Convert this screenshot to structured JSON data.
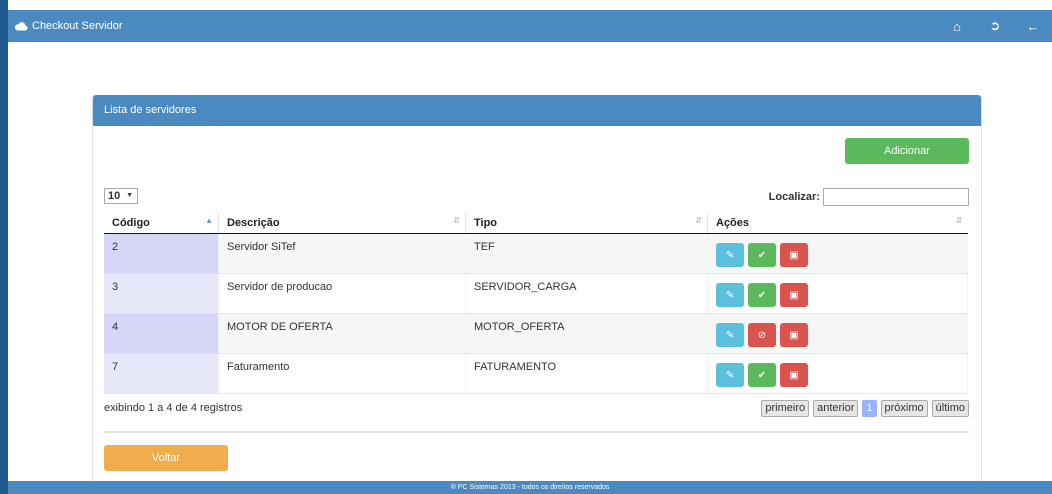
{
  "topbar": {
    "brand": "Checkout Servidor",
    "icons": [
      "home-icon",
      "sign-out-icon",
      "back-arrow-icon"
    ]
  },
  "panel": {
    "title": "Lista de servidores",
    "add_label": "Adicionar",
    "length_value": "10",
    "search_label": "Localizar:",
    "search_value": "",
    "columns": [
      "Código",
      "Descrição",
      "Tipo",
      "Ações"
    ],
    "rows": [
      {
        "codigo": "2",
        "descricao": "Servidor SiTef",
        "tipo": "TEF",
        "status_icon": "check-icon"
      },
      {
        "codigo": "3",
        "descricao": "Servidor de producao",
        "tipo": "SERVIDOR_CARGA",
        "status_icon": "check-icon"
      },
      {
        "codigo": "4",
        "descricao": "MOTOR DE OFERTA",
        "tipo": "MOTOR_OFERTA",
        "status_icon": "ban-icon"
      },
      {
        "codigo": "7",
        "descricao": "Faturamento",
        "tipo": "FATURAMENTO",
        "status_icon": "check-icon"
      }
    ],
    "info": "exibindo 1 a 4 de 4 registros",
    "pager": {
      "first": "primeiro",
      "prev": "anterior",
      "current": "1",
      "next": "próximo",
      "last": "último"
    },
    "back_label": "Voltar"
  },
  "footer": {
    "text": "® PC Sistemas 2013 - todos os direitos reservados"
  },
  "colors": {
    "primary": "#4a8ac0",
    "success": "#5cb85c",
    "info": "#5bc0de",
    "danger": "#d9534f",
    "warning": "#f0ad4e"
  }
}
